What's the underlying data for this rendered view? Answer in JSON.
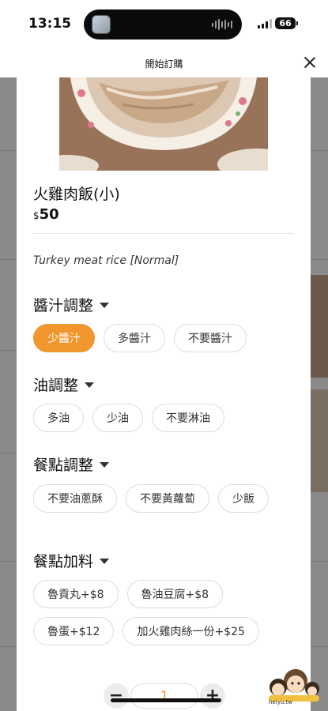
{
  "status_bar": {
    "time": "13:15",
    "battery": "66"
  },
  "header": {
    "title": "開始訂購"
  },
  "item": {
    "name": "火雞肉飯(小)",
    "currency": "$",
    "price": "50",
    "description": "Turkey meat rice [Normal]"
  },
  "sections": [
    {
      "title": "醬汁調整",
      "options": [
        "少醬汁",
        "多醬汁",
        "不要醬汁"
      ],
      "selected": "少醬汁"
    },
    {
      "title": "油調整",
      "options": [
        "多油",
        "少油",
        "不要淋油"
      ]
    },
    {
      "title": "餐點調整",
      "options": [
        "不要油蔥酥",
        "不要黃蘿蔔",
        "少飯"
      ]
    },
    {
      "title": "餐點加料",
      "options": [
        "魯貢丸+$8",
        "魯油豆腐+$8",
        "魯蛋+$12",
        "加火雞肉絲一份+$25"
      ]
    }
  ],
  "quantity": {
    "minus_label": "−",
    "value": "1",
    "plus_label": "+"
  },
  "watermark": {
    "text": "heiyu.tw"
  },
  "colors": {
    "accent": "#f0962c",
    "overlay": "#8a8a8a"
  }
}
